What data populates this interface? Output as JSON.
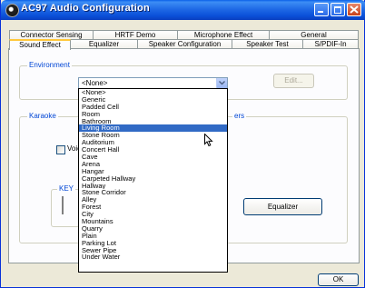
{
  "window": {
    "title": "AC97 Audio Configuration"
  },
  "tabs_row1": [
    {
      "label": "Connector Sensing"
    },
    {
      "label": "HRTF Demo"
    },
    {
      "label": "Microphone Effect"
    },
    {
      "label": "General"
    }
  ],
  "tabs_row2": [
    {
      "label": "Sound Effect",
      "active": true
    },
    {
      "label": "Equalizer"
    },
    {
      "label": "Speaker Configuration"
    },
    {
      "label": "Speaker Test"
    },
    {
      "label": "S/PDIF-In"
    }
  ],
  "environment": {
    "group_label": "Environment",
    "selected": "<None>",
    "edit_label": "Edit...",
    "options": [
      "<None>",
      "Generic",
      "Padded Cell",
      "Room",
      "Bathroom",
      "Living Room",
      "Stone Room",
      "Auditorium",
      "Concert Hall",
      "Cave",
      "Arena",
      "Hangar",
      "Carpeted Hallway",
      "Hallway",
      "Stone Corridor",
      "Alley",
      "Forest",
      "City",
      "Mountains",
      "Quarry",
      "Plain",
      "Parking Lot",
      "Sewer Pipe",
      "Under Water"
    ],
    "highlighted": "Living Room"
  },
  "karaoke": {
    "group_label": "Karaoke",
    "voice_label_partial": "Voic",
    "key_label": "KEY"
  },
  "equalizer_partial_label": "ers",
  "equalizer_button": "Equalizer",
  "ok_label": "OK"
}
